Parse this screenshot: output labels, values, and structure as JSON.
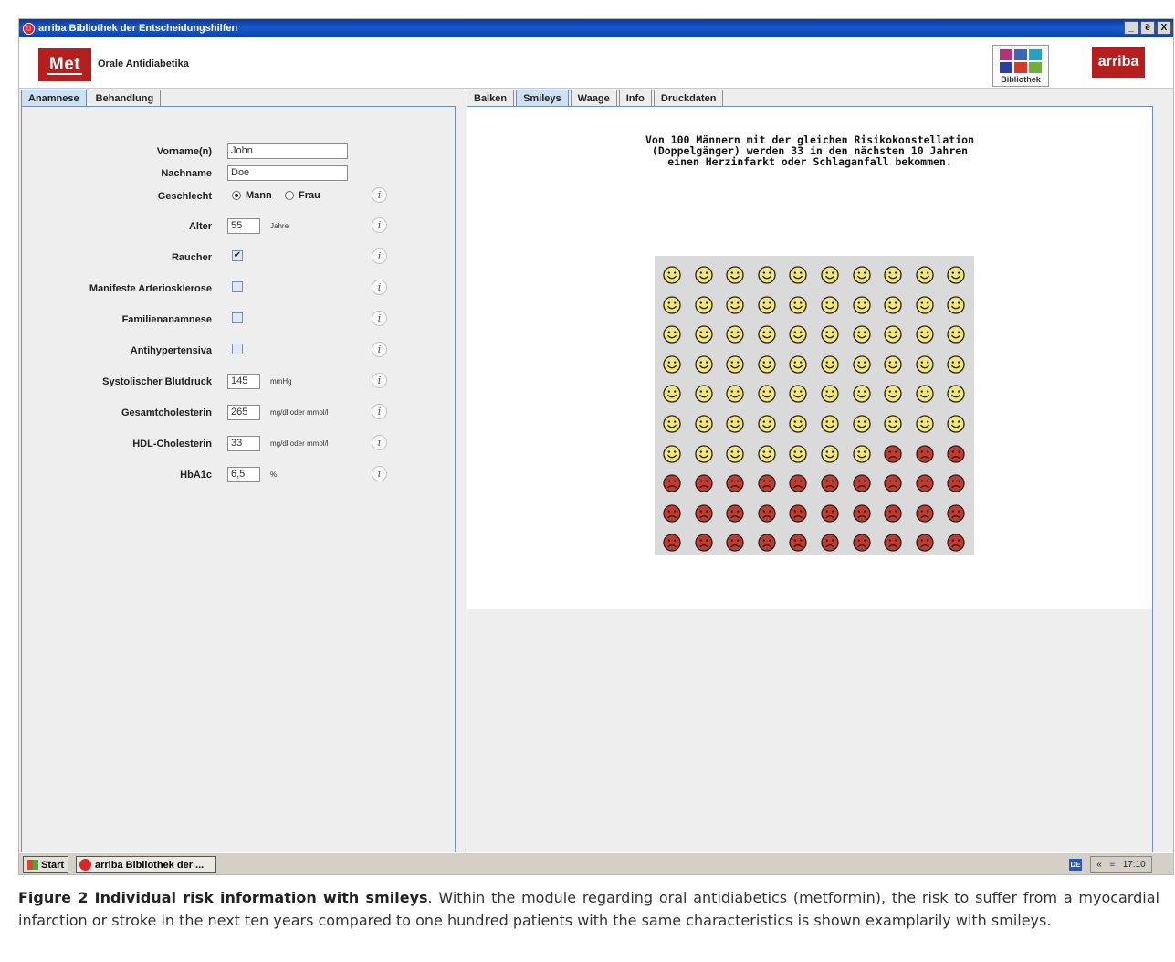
{
  "window": {
    "title": "arriba Bibliothek der Entscheidungshilfen",
    "buttons": [
      "_",
      "ё",
      "X"
    ]
  },
  "header": {
    "module_logo": "Met",
    "module_title": "Orale Antidiabetika",
    "library_label": "Bibliothek",
    "brand_logo": "arriba"
  },
  "left_tabs": [
    {
      "label": "Anamnese",
      "active": true
    },
    {
      "label": "Behandlung",
      "active": false
    }
  ],
  "form": {
    "first_name": {
      "label": "Vorname(n)",
      "value": "John"
    },
    "last_name": {
      "label": "Nachname",
      "value": "Doe"
    },
    "gender": {
      "label": "Geschlecht",
      "options": [
        "Mann",
        "Frau"
      ],
      "selected": "Mann"
    },
    "age": {
      "label": "Alter",
      "value": "55",
      "unit": "Jahre"
    },
    "smoker": {
      "label": "Raucher",
      "checked": true
    },
    "arteriosclerosis": {
      "label": "Manifeste Arteriosklerose",
      "checked": false
    },
    "family_history": {
      "label": "Familienanamnese",
      "checked": false
    },
    "antihypertensives": {
      "label": "Antihypertensiva",
      "checked": false
    },
    "systolic_bp": {
      "label": "Systolischer Blutdruck",
      "value": "145",
      "unit": "mmHg"
    },
    "total_cholesterol": {
      "label": "Gesamtcholesterin",
      "value": "265",
      "unit": "mg/dl oder mmol/l"
    },
    "hdl_cholesterol": {
      "label": "HDL-Cholesterin",
      "value": "33",
      "unit": "mg/dl oder mmol/l"
    },
    "hba1c": {
      "label": "HbA1c",
      "value": "6,5",
      "unit": "%"
    }
  },
  "right_tabs": [
    {
      "label": "Balken",
      "active": false
    },
    {
      "label": "Smileys",
      "active": true
    },
    {
      "label": "Waage",
      "active": false
    },
    {
      "label": "Info",
      "active": false
    },
    {
      "label": "Druckdaten",
      "active": false
    }
  ],
  "result": {
    "headline_lines": [
      "Von 100 Männern mit der gleichen Risikokonstellation",
      "(Doppelgänger) werden 33 in den nächsten 10 Jahren",
      "einen Herzinfarkt oder Schlaganfall bekommen."
    ],
    "total": 100,
    "affected": 33,
    "columns": 10,
    "colors": {
      "happy": "#f3e77a",
      "sad": "#c23b2e",
      "outline": "#222222",
      "box": "#dadada"
    }
  },
  "taskbar": {
    "start_label": "Start",
    "task_label": "arriba Bibliothek der ...",
    "lang": "DE",
    "tray_arrows": "«",
    "time": "17:10"
  },
  "caption": {
    "bold": "Figure 2 Individual risk information with smileys",
    "text": ". Within the module regarding oral antidiabetics (metformin), the risk to suffer from a myocardial infarction or stroke in the next ten years compared to one hundred patients with the same characteristics is shown examplarily with smileys."
  }
}
